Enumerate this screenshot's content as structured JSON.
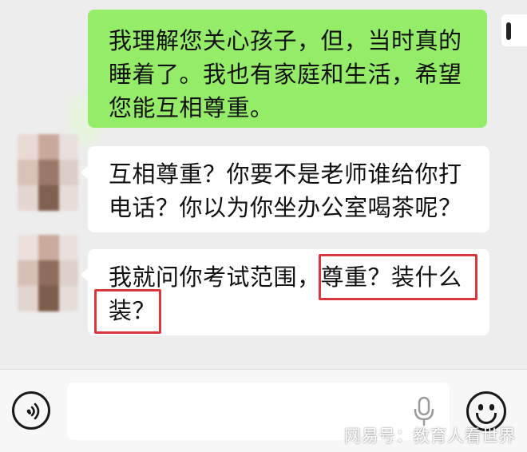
{
  "chat": {
    "messages": [
      {
        "side": "outgoing",
        "lines": [
          "我理解您关心孩子，但，当时真的",
          "睡着了。我也有家庭和生活，希望",
          "您能互相尊重。"
        ]
      },
      {
        "side": "incoming",
        "lines": [
          "互相尊重？你要不是老师谁给你打",
          "电话？你以为你坐办公室喝茶呢？"
        ]
      },
      {
        "side": "incoming",
        "lines": [
          "我就问你考试范围，尊重？装什么",
          "装？"
        ]
      }
    ]
  },
  "input_bar": {
    "placeholder": "",
    "voice_icon": "voice-toggle-icon",
    "mic_icon": "microphone-icon",
    "emoji_icon": "emoji-icon"
  },
  "watermark": {
    "text": "网易号：教育人看世界"
  },
  "colors": {
    "outgoing_bubble": "#95ec69",
    "incoming_bubble": "#ffffff",
    "background": "#ededed",
    "highlight": "#d9363e"
  }
}
